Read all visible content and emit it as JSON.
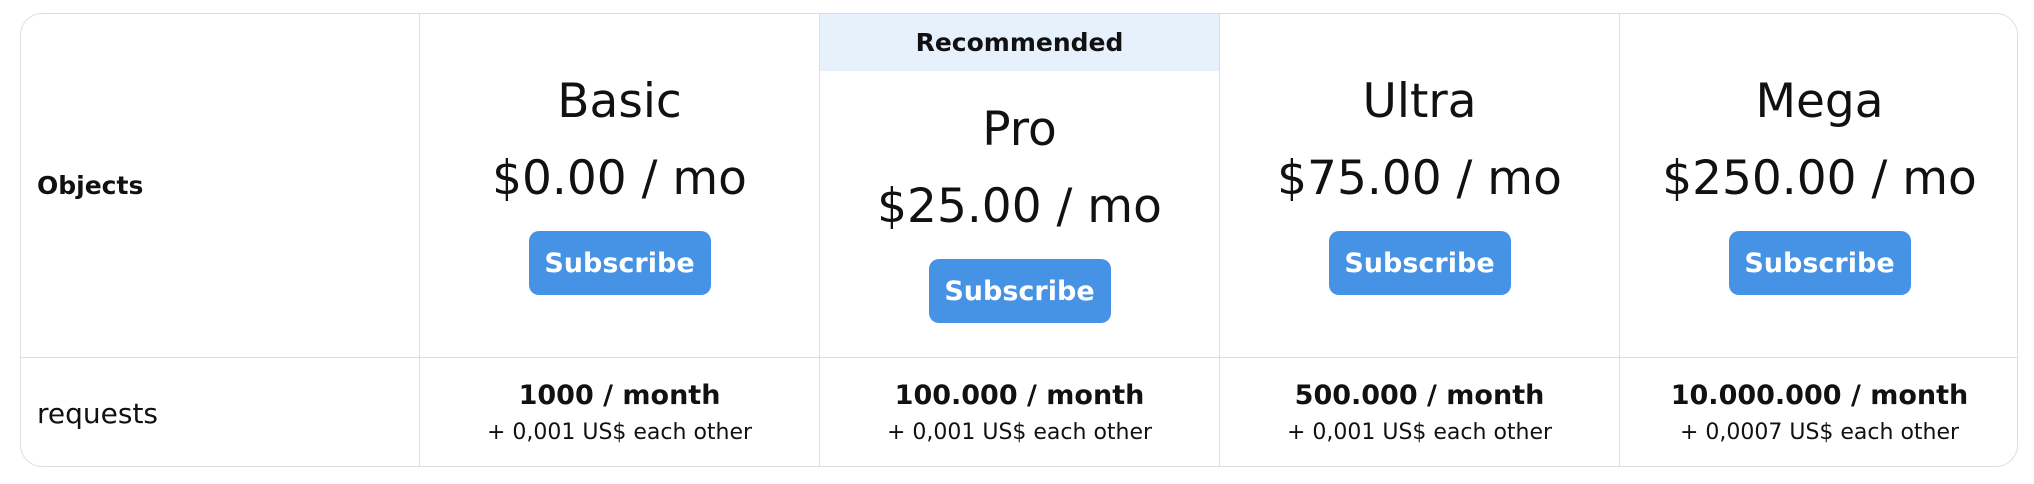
{
  "row_labels": {
    "objects": "Objects",
    "requests": "requests"
  },
  "recommended_label": "Recommended",
  "subscribe_label": "Subscribe",
  "plans": [
    {
      "name": "Basic",
      "price": "$0.00 / mo",
      "quota": "1000 / month",
      "extra": "+ 0,001 US$ each other"
    },
    {
      "name": "Pro",
      "price": "$25.00 / mo",
      "quota": "100.000 / month",
      "extra": "+ 0,001 US$ each other"
    },
    {
      "name": "Ultra",
      "price": "$75.00 / mo",
      "quota": "500.000 / month",
      "extra": "+ 0,001 US$ each other"
    },
    {
      "name": "Mega",
      "price": "$250.00 / mo",
      "quota": "10.000.000 / month",
      "extra": "+ 0,0007 US$ each other"
    }
  ],
  "colors": {
    "button": "#4693e5",
    "recommended_bg": "#e6f1fc",
    "border": "#dedede"
  }
}
